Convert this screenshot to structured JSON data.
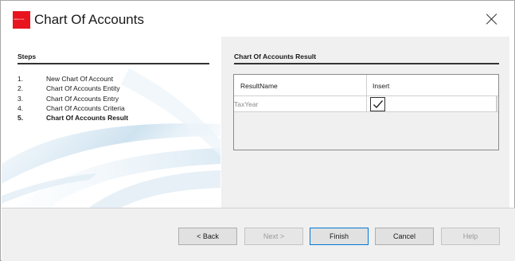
{
  "window": {
    "title": "Chart Of Accounts",
    "logo_text": "Vertex Inc"
  },
  "steps": {
    "header": "Steps",
    "items": [
      {
        "num": "1.",
        "label": "New Chart Of Account",
        "active": false
      },
      {
        "num": "2.",
        "label": "Chart Of Accounts Entity",
        "active": false
      },
      {
        "num": "3.",
        "label": "Chart Of Accounts Entry",
        "active": false
      },
      {
        "num": "4.",
        "label": "Chart Of Accounts Criteria",
        "active": false
      },
      {
        "num": "5.",
        "label": "Chart Of Accounts Result",
        "active": true
      }
    ]
  },
  "result": {
    "header": "Chart Of Accounts Result",
    "columns": [
      "ResultName",
      "Insert"
    ],
    "rows": [
      {
        "result_name": "TaxYear",
        "insert": true
      }
    ]
  },
  "buttons": {
    "back": "< Back",
    "next": "Next >",
    "finish": "Finish",
    "cancel": "Cancel",
    "help": "Help"
  },
  "colors": {
    "logo": "#e8141e",
    "pane_bg": "#f0f0f0",
    "default_button_border": "#0078d7"
  }
}
